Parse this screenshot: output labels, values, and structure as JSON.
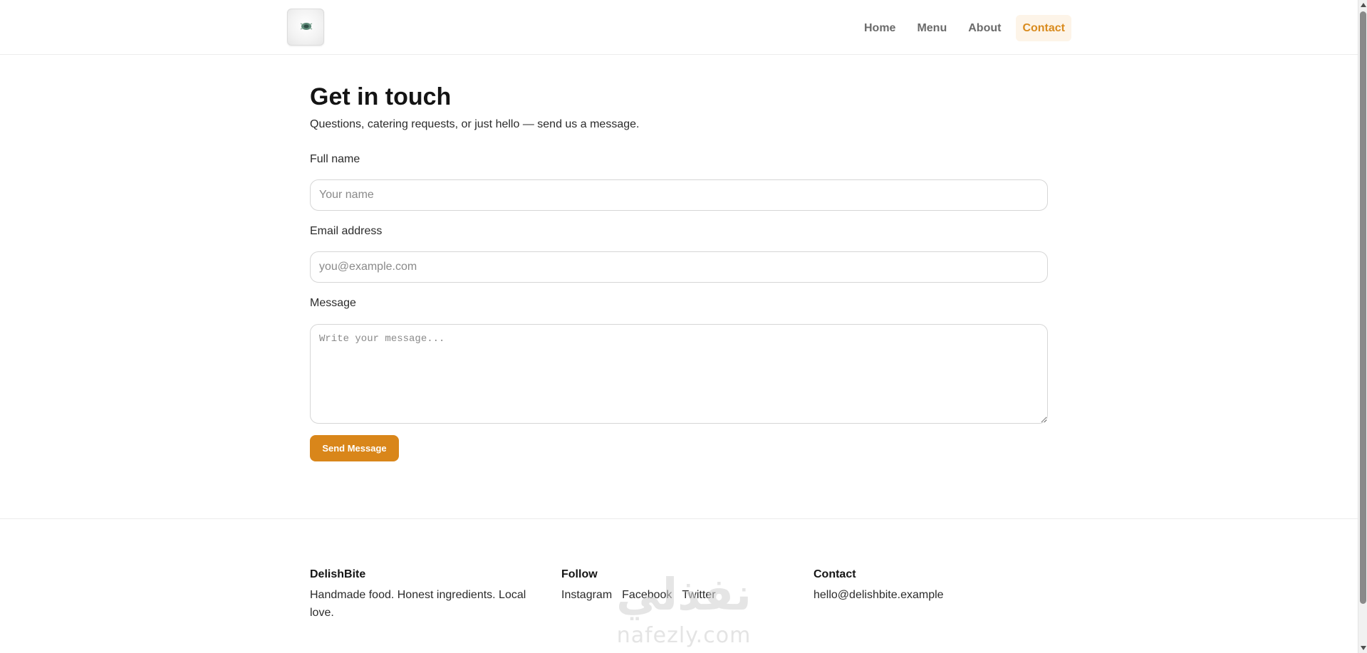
{
  "header": {
    "logo_alt": "DelishBite logo",
    "nav": [
      {
        "label": "Home",
        "active": false
      },
      {
        "label": "Menu",
        "active": false
      },
      {
        "label": "About",
        "active": false
      },
      {
        "label": "Contact",
        "active": true
      }
    ]
  },
  "contact": {
    "title": "Get in touch",
    "subtitle": "Questions, catering requests, or just hello — send us a message.",
    "name_label": "Full name",
    "name_placeholder": "Your name",
    "email_label": "Email address",
    "email_placeholder": "you@example.com",
    "message_label": "Message",
    "message_placeholder": "Write your message...",
    "submit_label": "Send Message"
  },
  "footer": {
    "brand": {
      "heading": "DelishBite",
      "text": "Handmade food. Honest ingredients. Local love."
    },
    "follow": {
      "heading": "Follow",
      "links": [
        "Instagram",
        "Facebook",
        "Twitter"
      ]
    },
    "contact": {
      "heading": "Contact",
      "email": "hello@delishbite.example"
    }
  },
  "watermark": {
    "arabic": "نفذلي",
    "latin": "nafezly.com"
  },
  "colors": {
    "accent": "#d9861a",
    "active_nav_bg": "#fdf4e8",
    "active_nav_text": "#d98b1e",
    "border": "#d6d6d6"
  }
}
